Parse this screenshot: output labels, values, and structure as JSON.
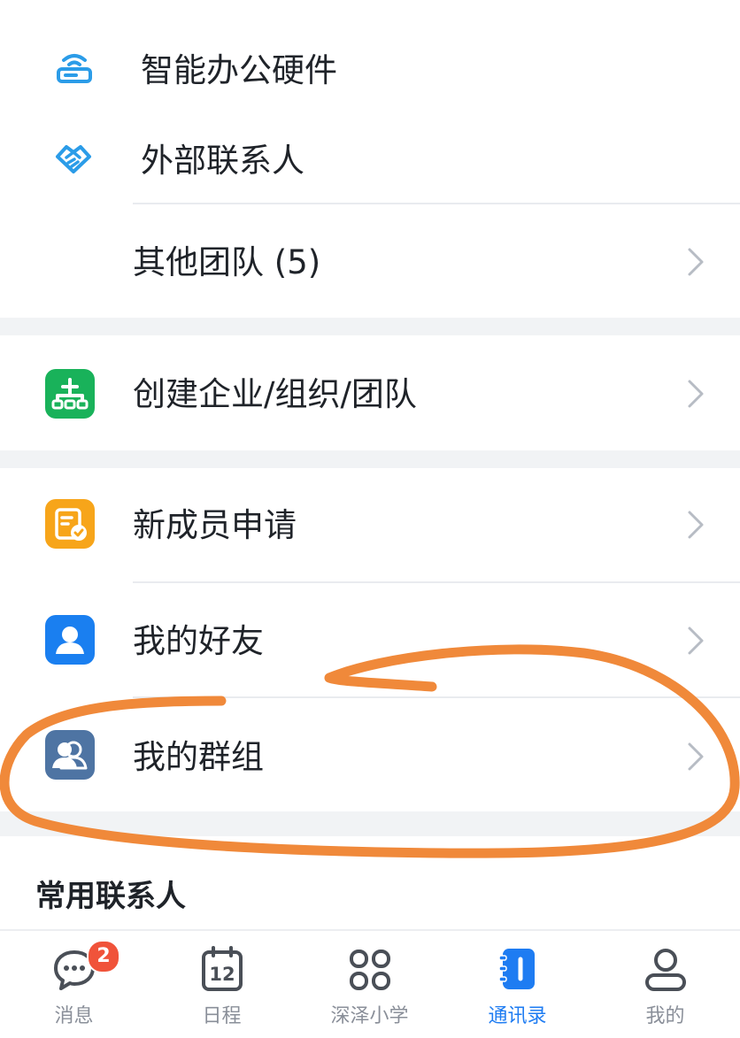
{
  "menu": {
    "office_hardware": "智能办公硬件",
    "external_contacts": "外部联系人",
    "other_teams": "其他团队 (5)",
    "create_org": "创建企业/组织/团队",
    "new_member_requests": "新成员申请",
    "my_friends": "我的好友",
    "my_groups": "我的群组"
  },
  "section": {
    "frequent_contacts": "常用联系人"
  },
  "tabbar": {
    "messages": {
      "label": "消息",
      "badge": "2"
    },
    "calendar": {
      "label": "日程",
      "day": "12"
    },
    "workspace": {
      "label": "深泽小学"
    },
    "contacts": {
      "label": "通讯录"
    },
    "me": {
      "label": "我的"
    }
  },
  "colors": {
    "accent": "#1e7cf2",
    "green_icon": "#19b25a",
    "orange_icon": "#f7a51a",
    "blue_icon": "#1a7ff0",
    "slate_icon": "#4e74a3",
    "annotation": "#f0893a",
    "badge": "#f0533a"
  },
  "icons": {
    "office_hardware": "router-icon",
    "external_contacts": "handshake-icon",
    "create_org": "org-chart-icon",
    "new_member_requests": "request-calendar-icon",
    "my_friends": "person-icon",
    "my_groups": "group-icon"
  }
}
